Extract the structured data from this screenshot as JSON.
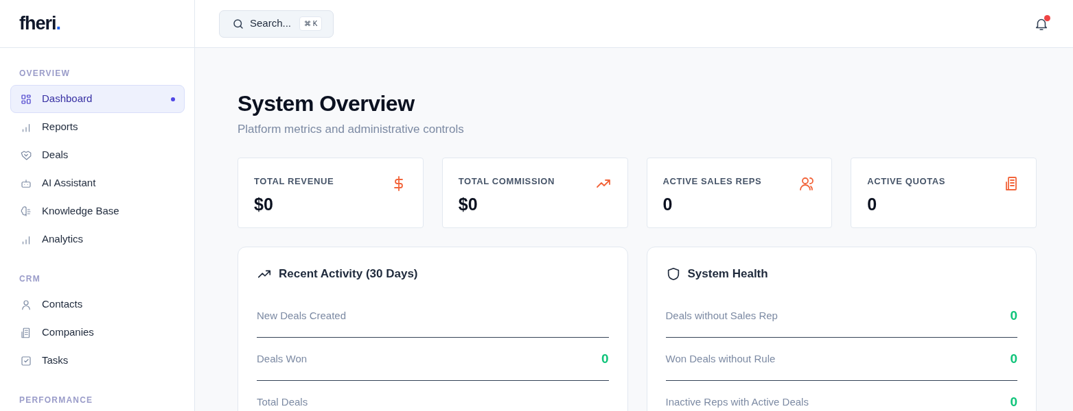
{
  "brand": {
    "name": "fheri",
    "dot": "."
  },
  "search": {
    "label": "Search...",
    "shortcut": "⌘ K"
  },
  "notifications": {
    "unread": true
  },
  "sidebar": {
    "sections": [
      {
        "title": "OVERVIEW",
        "items": [
          {
            "label": "Dashboard",
            "selected": true
          },
          {
            "label": "Reports",
            "selected": false
          },
          {
            "label": "Deals",
            "selected": false
          },
          {
            "label": "AI Assistant",
            "selected": false
          },
          {
            "label": "Knowledge Base",
            "selected": false
          },
          {
            "label": "Analytics",
            "selected": false
          }
        ]
      },
      {
        "title": "CRM",
        "items": [
          {
            "label": "Contacts",
            "selected": false
          },
          {
            "label": "Companies",
            "selected": false
          },
          {
            "label": "Tasks",
            "selected": false
          }
        ]
      },
      {
        "title": "PERFORMANCE"
      }
    ]
  },
  "page": {
    "title": "System Overview",
    "subtitle": "Platform metrics and administrative controls"
  },
  "stats": [
    {
      "label": "TOTAL REVENUE",
      "value": "$0"
    },
    {
      "label": "TOTAL COMMISSION",
      "value": "$0"
    },
    {
      "label": "ACTIVE SALES REPS",
      "value": "0"
    },
    {
      "label": "ACTIVE QUOTAS",
      "value": "0"
    }
  ],
  "panels": [
    {
      "title": "Recent Activity (30 Days)",
      "rows": [
        {
          "label": "New Deals Created"
        },
        {
          "label": "Deals Won",
          "value": "0"
        },
        {
          "label": "Total Deals"
        }
      ]
    },
    {
      "title": "System Health",
      "rows": [
        {
          "label": "Deals without Sales Rep",
          "value": "0"
        },
        {
          "label": "Won Deals without Rule",
          "value": "0"
        },
        {
          "label": "Inactive Reps with Active Deals",
          "value": "0"
        }
      ]
    }
  ]
}
